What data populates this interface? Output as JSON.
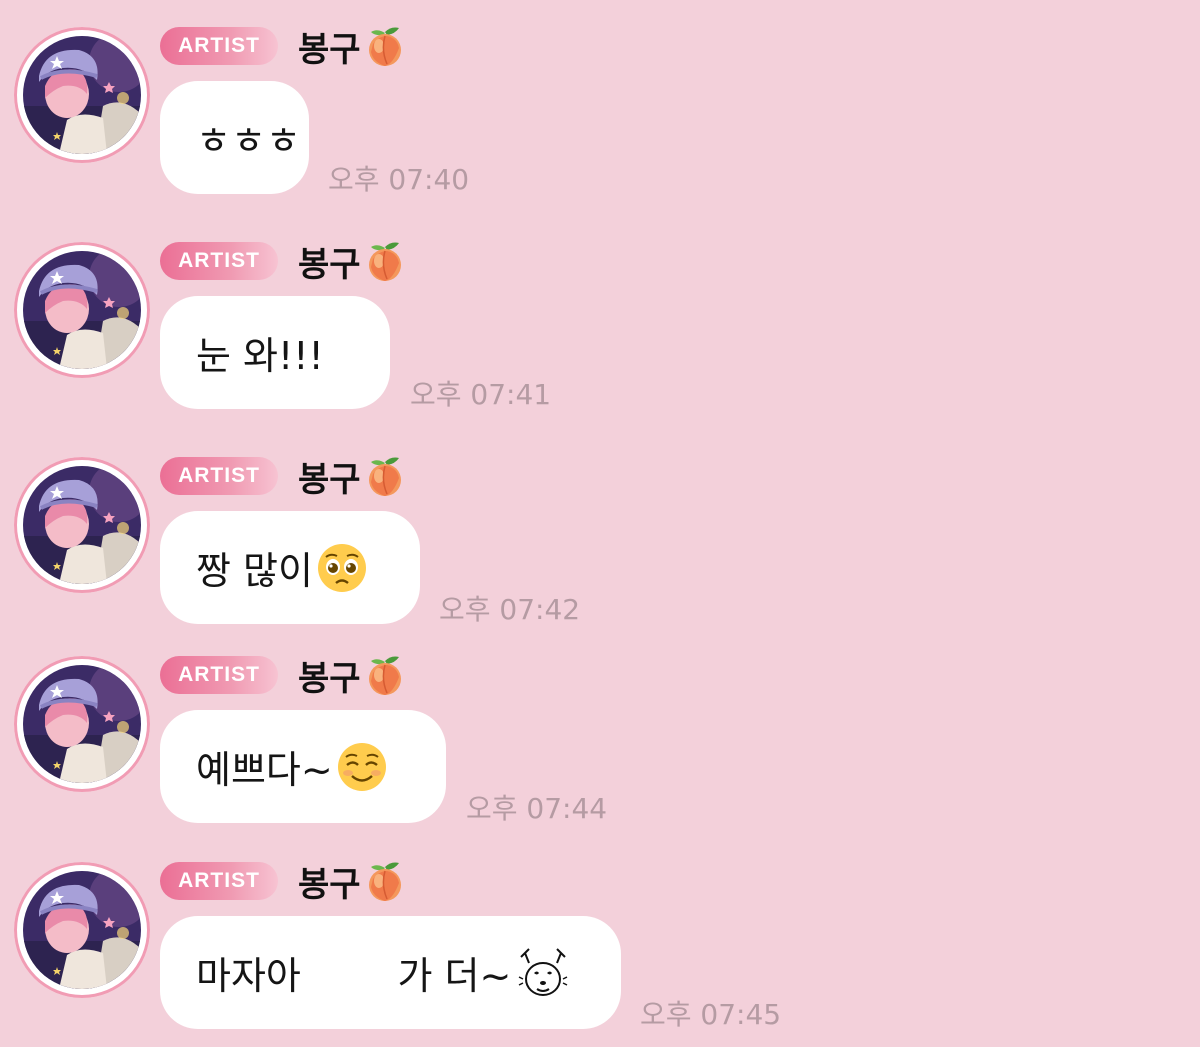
{
  "colors": {
    "background": "#f3d0da",
    "badge_gradient_start": "#eb6f95",
    "badge_gradient_end": "#f7c3d2",
    "bubble": "#ffffff",
    "timestamp": "#b59ba3",
    "avatar_ring": "#f19cb4"
  },
  "messages": [
    {
      "badge": "ARTIST",
      "sender": "봉구",
      "sender_icon": "peach-icon",
      "text": "ㅎㅎㅎ",
      "emoji": null,
      "time": "오후 07:40"
    },
    {
      "badge": "ARTIST",
      "sender": "봉구",
      "sender_icon": "peach-icon",
      "text": "눈 와!!!",
      "emoji": null,
      "time": "오후 07:41"
    },
    {
      "badge": "ARTIST",
      "sender": "봉구",
      "sender_icon": "peach-icon",
      "text": "짱 많이",
      "emoji": "pleading-face-icon",
      "time": "오후 07:42"
    },
    {
      "badge": "ARTIST",
      "sender": "봉구",
      "sender_icon": "peach-icon",
      "text": "예쁘다~",
      "emoji": "smiling-face-icon",
      "time": "오후 07:44"
    },
    {
      "badge": "ARTIST",
      "sender": "봉구",
      "sender_icon": "peach-icon",
      "text": "마자아        가 더~",
      "emoji": "deer-sticker-icon",
      "time": "오후 07:45"
    }
  ]
}
